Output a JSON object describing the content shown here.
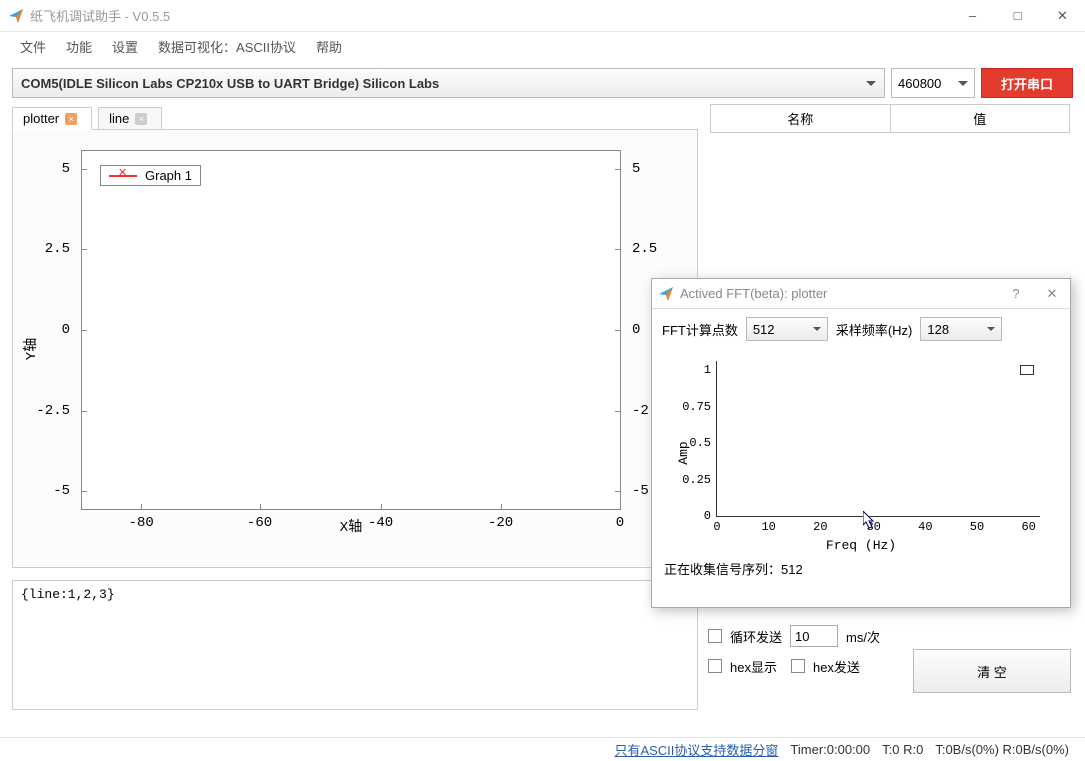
{
  "window_title": "纸飞机调试助手 - V0.5.5",
  "menu": [
    "文件",
    "功能",
    "设置",
    "数据可视化：ASCII协议",
    "帮助"
  ],
  "com_port": "COM5(IDLE  Silicon Labs CP210x USB to UART Bridge) Silicon Labs",
  "baud": "460800",
  "open_btn": "打开串口",
  "tabs": [
    {
      "label": "plotter",
      "active": true
    },
    {
      "label": "line",
      "active": false
    }
  ],
  "chart_data": {
    "type": "line",
    "series": [
      {
        "name": "Graph 1",
        "values": []
      }
    ],
    "xlabel": "X轴",
    "ylabel": "Y轴",
    "xlim": [
      -90,
      0
    ],
    "ylim": [
      -6,
      6
    ],
    "xticks": [
      -80,
      -60,
      -40,
      -20,
      0
    ],
    "yticks": [
      -5,
      -2.5,
      0,
      2.5,
      5
    ]
  },
  "side_headers": {
    "name": "名称",
    "value": "值"
  },
  "input_area": "{line:1,2,3}",
  "controls": {
    "loop_send": "循环发送",
    "interval": "10",
    "interval_unit": "ms/次",
    "hex_show": "hex显示",
    "hex_send": "hex发送",
    "clear_btn": "清 空"
  },
  "status": {
    "link": "只有ASCII协议支持数据分窗",
    "timer": "Timer:0:00:00",
    "tr": "T:0 R:0",
    "rate": "T:0B/s(0%) R:0B/s(0%)"
  },
  "fft": {
    "title": "Actived FFT(beta): plotter",
    "param1_label": "FFT计算点数",
    "param1_value": "512",
    "param2_label": "采样频率(Hz)",
    "param2_value": "128",
    "status_prefix": "正在收集信号序列：",
    "status_value": "512",
    "chart_data": {
      "type": "line",
      "xlabel": "Freq (Hz)",
      "ylabel": "Amp",
      "xlim": [
        0,
        64
      ],
      "ylim": [
        0,
        1.1
      ],
      "xticks": [
        0,
        10,
        20,
        30,
        40,
        50,
        60
      ],
      "yticks": [
        0,
        0.25,
        0.5,
        0.75,
        1
      ],
      "series": [
        {
          "name": "",
          "values": []
        }
      ]
    }
  }
}
